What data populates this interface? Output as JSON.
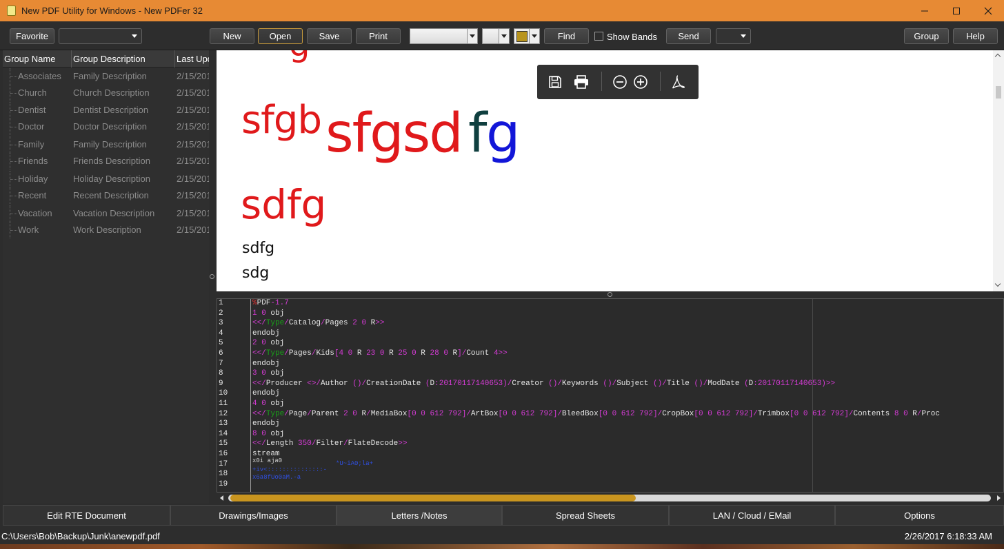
{
  "window": {
    "title": "New PDF Utility for Windows - New PDFer 32",
    "minimize": "minimize",
    "maximize": "maximize",
    "close": "close"
  },
  "toolbar": {
    "favorite": "Favorite",
    "new": "New",
    "open": "Open",
    "save": "Save",
    "print": "Print",
    "find": "Find",
    "show_bands": "Show Bands",
    "send": "Send",
    "group": "Group",
    "help": "Help",
    "color_swatch": "#b8941e"
  },
  "grid": {
    "columns": [
      "Group Name",
      "Group Description",
      "Last Upd"
    ],
    "rows": [
      {
        "name": "Associates",
        "desc": "Family Description",
        "date": "2/15/201"
      },
      {
        "name": "Church",
        "desc": "Church Description",
        "date": "2/15/201"
      },
      {
        "name": "Dentist",
        "desc": "Dentist Description",
        "date": "2/15/201"
      },
      {
        "name": "Doctor",
        "desc": "Doctor Description",
        "date": "2/15/201"
      },
      {
        "name": "Family",
        "desc": "Family Description",
        "date": "2/15/201"
      },
      {
        "name": "Friends",
        "desc": "Friends Description",
        "date": "2/15/201"
      },
      {
        "name": "Holiday",
        "desc": "Holiday Description",
        "date": "2/15/201"
      },
      {
        "name": "Recent",
        "desc": "Recent Description",
        "date": "2/15/201"
      },
      {
        "name": "Vacation",
        "desc": "Vacation Description",
        "date": "2/15/201"
      },
      {
        "name": "Work",
        "desc": "Work Description",
        "date": "2/15/201"
      }
    ]
  },
  "preview": {
    "cut_top": "g",
    "line1_small": "sfgb",
    "line1_big": "sfgsd",
    "line1_f": "f",
    "line1_g": "g",
    "line2": "sdfg",
    "line3": "sdfg",
    "line4": "sdg"
  },
  "code": {
    "line_numbers": [
      "1",
      "2",
      "3",
      "4",
      "5",
      "6",
      "7",
      "8",
      "9",
      "10",
      "11",
      "12",
      "13",
      "14",
      "15",
      "16",
      "17",
      "18",
      "19"
    ]
  },
  "tabs": [
    "Edit RTE Document",
    "Drawings/Images",
    "Letters /Notes",
    "Spread Sheets",
    "LAN / Cloud / EMail",
    "Options"
  ],
  "status": {
    "path": "C:\\Users\\Bob\\Backup\\Junk\\anewpdf.pdf",
    "datetime": "2/26/2017 6:18:33 AM"
  }
}
